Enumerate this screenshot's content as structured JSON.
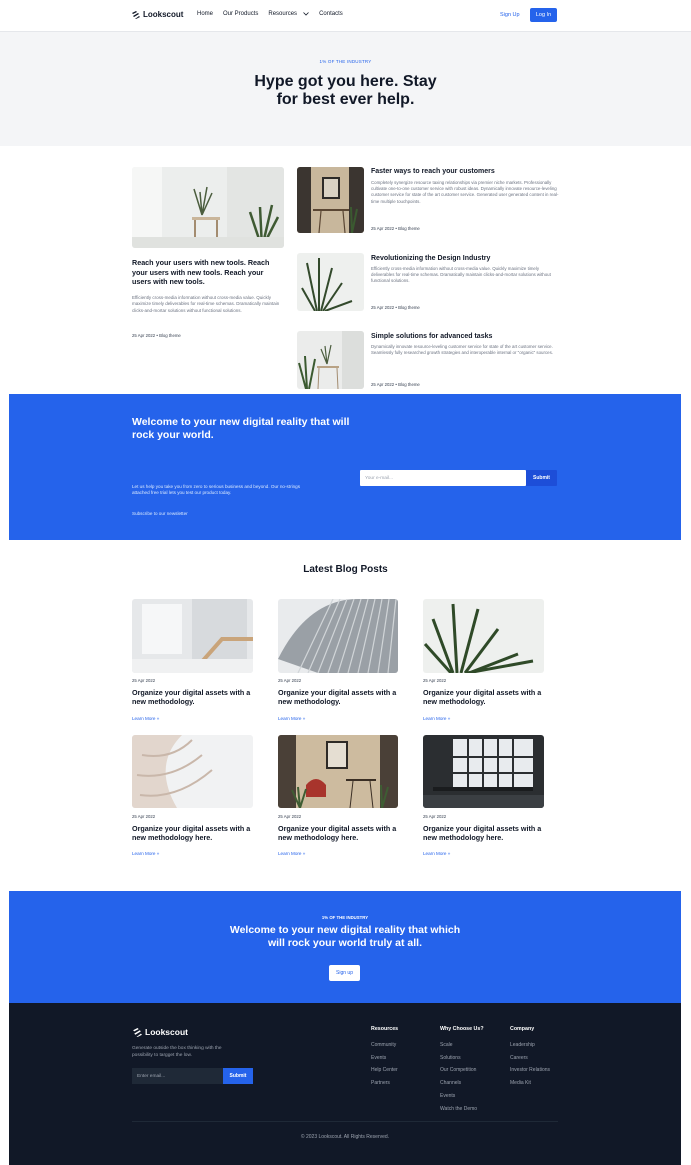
{
  "nav": {
    "brand": "Lookscout",
    "links": [
      "Home",
      "Our Products",
      "Resources",
      "Contacts"
    ],
    "signup": "Sign Up",
    "login": "Log In"
  },
  "hero": {
    "eyebrow": "1% OF THE INDUSTRY",
    "title_line1": "Hype got you here. Stay",
    "title_line2": "for best ever help."
  },
  "featured": {
    "main": {
      "title": "Reach your users with new tools. Reach your users with new tools. Reach your users with new tools.",
      "body": "Efficiently cross-media information without cross-media value. Quickly maximize timely deliverables for real-time schemas. Dramatically maintain clicks-and-mortar solutions without functional solutions.",
      "meta": "25 Apr 2022 • Blog theme"
    },
    "side": [
      {
        "title": "Faster ways to reach your customers",
        "body": "Completely synergize resource taxing relationships via premier niche markets. Professionally cultivate one-to-one customer service with robust ideas. Dynamically innovate resource-leveling customer service for state of the art customer service. Generated user generated content in real-time multiple touchpoints.",
        "meta": "25 Apr 2022 • Blog theme"
      },
      {
        "title": "Revolutionizing the Design Industry",
        "body": "Efficiently cross-media information without cross-media value. Quickly maximize timely deliverables for real-time schemas. Dramatically maintain clicks-and-mortar solutions without functional solutions.",
        "meta": "25 Apr 2022 • Blog theme"
      },
      {
        "title": "Simple solutions for advanced tasks",
        "body": "Dynamically innovate resource-leveling customer service for state of the art customer service. Seamlessly fully researched growth strategies and interoperable internal or \"organic\" sources.",
        "meta": "25 Apr 2022 • Blog theme"
      }
    ]
  },
  "newsletter": {
    "title": "Welcome to your new digital reality that will rock your world.",
    "body": "Let us help you take you from zero to serious business and beyond. Our no-strings attached free trial lets you test our product today.",
    "link": "Subscribe to our newsletter",
    "placeholder": "Your e-mail...",
    "submit": "Submit"
  },
  "blog": {
    "heading": "Latest Blog Posts",
    "cards": [
      {
        "date": "25 Apr 2022",
        "title": "Organize your digital assets with a new methodology.",
        "link": "Learn More »"
      },
      {
        "date": "25 Apr 2022",
        "title": "Organize your digital assets with a new methodology.",
        "link": "Learn More »"
      },
      {
        "date": "25 Apr 2022",
        "title": "Organize your digital assets with a new methodology.",
        "link": "Learn More »"
      },
      {
        "date": "25 Apr 2022",
        "title": "Organize your digital assets with a new methodology here.",
        "link": "Learn More »"
      },
      {
        "date": "25 Apr 2022",
        "title": "Organize your digital assets with a new methodology here.",
        "link": "Learn More »"
      },
      {
        "date": "25 Apr 2022",
        "title": "Organize your digital assets with a new methodology here.",
        "link": "Learn More »"
      }
    ]
  },
  "cta": {
    "eyebrow": "1% OF THE INDUSTRY",
    "title": "Welcome to your new digital reality that which will rock your world truly at all.",
    "button": "Sign up"
  },
  "footer": {
    "brand": "Lookscout",
    "tagline": "Generate outside the box thinking with the possibility to targget the low.",
    "placeholder": "Enter email...",
    "submit": "Submit",
    "columns": [
      {
        "title": "Resources",
        "items": [
          "Community",
          "Events",
          "Help Center",
          "Partners"
        ]
      },
      {
        "title": "Why Choose Us?",
        "items": [
          "Scale",
          "Solutions",
          "Our Competition",
          "Channels",
          "Events",
          "Watch the Demo"
        ]
      },
      {
        "title": "Company",
        "items": [
          "Leadership",
          "Careers",
          "Investor Relations",
          "Media Kit"
        ]
      }
    ],
    "copyright": "© 2023 Lookscout. All Rights Reserved."
  },
  "colors": {
    "accent": "#2563eb",
    "footer_bg": "#111827",
    "hero_bg": "#f4f5f7"
  }
}
